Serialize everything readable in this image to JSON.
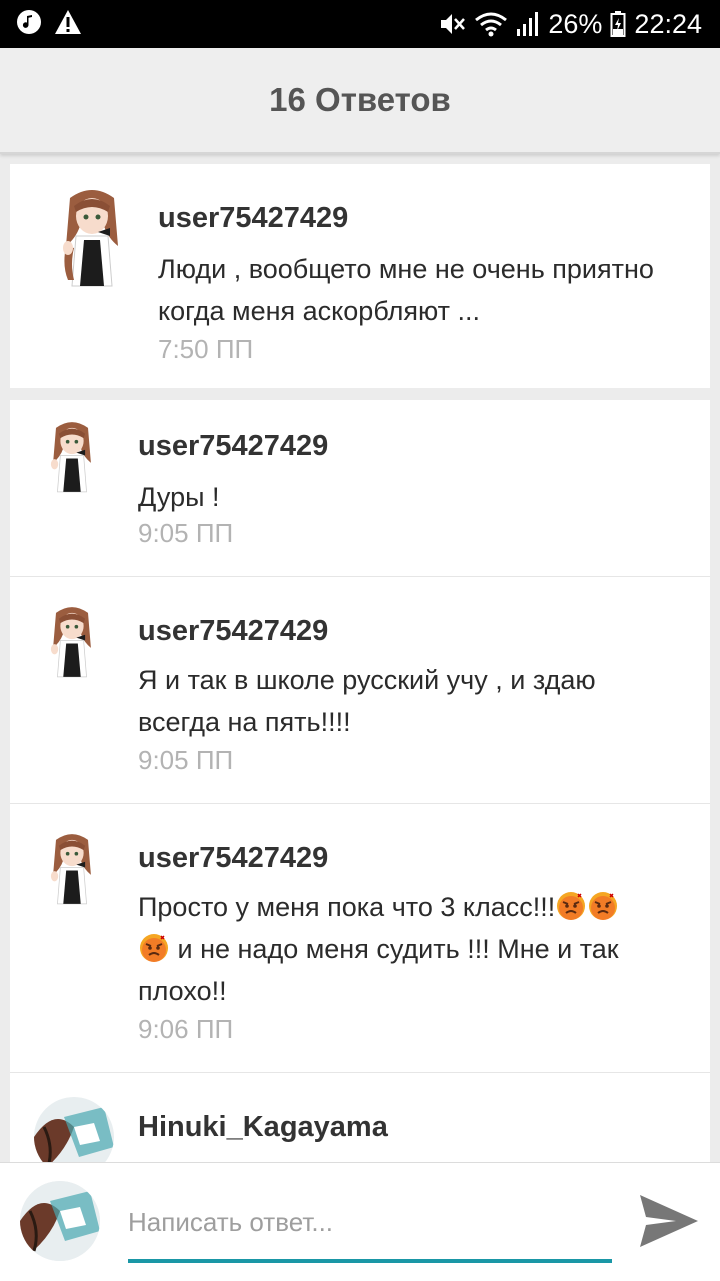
{
  "status_bar": {
    "battery": "26%",
    "time": "22:24",
    "icons": [
      "music-icon",
      "warning-icon",
      "mute-icon",
      "wifi-icon",
      "signal-icon",
      "battery-icon"
    ]
  },
  "header": {
    "title": "16 Ответов"
  },
  "root_comment": {
    "username": "user75427429",
    "text": "Люди , вообщето мне не очень приятно когда меня аскорбляют ...",
    "time": "7:50 ПП"
  },
  "replies": [
    {
      "username": "user75427429",
      "text": "Дуры !",
      "time": "9:05 ПП"
    },
    {
      "username": "user75427429",
      "text": "Я и так в школе русский учу , и здаю всегда на пять!!!!",
      "time": "9:05 ПП"
    },
    {
      "username": "user75427429",
      "text_part1": "Просто у меня пока что 3 класс!!!",
      "text_part2": " и не надо меня судить !!! Мне и так плохо!!",
      "emoji": "angry-face",
      "time": "9:06 ПП"
    },
    {
      "username": "Hinuki_Kagayama"
    }
  ],
  "composer": {
    "placeholder": "Написать ответ...",
    "value": ""
  },
  "colors": {
    "accent": "#1a97a6",
    "header_bg": "#eeeeee",
    "page_bg": "#ececec",
    "time_text": "#b3b3b3"
  }
}
